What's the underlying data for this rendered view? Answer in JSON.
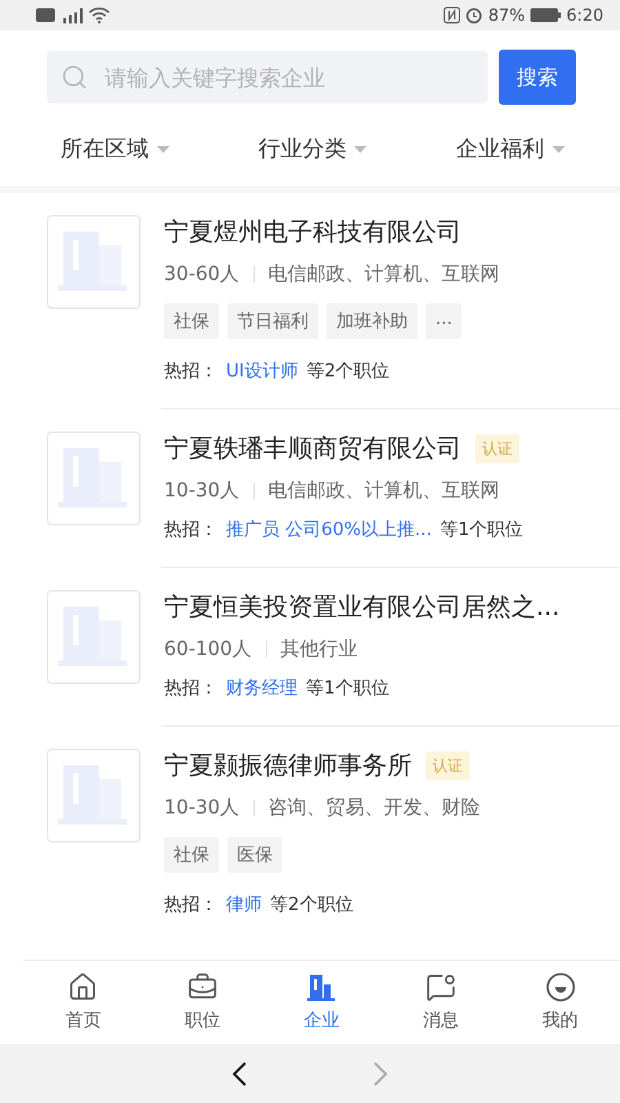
{
  "status_bar": {
    "battery": "87%",
    "time": "6:20"
  },
  "search": {
    "placeholder": "请输入关键字搜索企业",
    "button": "搜索"
  },
  "filters": [
    {
      "label": "所在区域"
    },
    {
      "label": "行业分类"
    },
    {
      "label": "企业福利"
    }
  ],
  "companies": [
    {
      "name": "宁夏煜州电子科技有限公司",
      "verified": false,
      "size": "30-60人",
      "industry": "电信邮政、计算机、互联网",
      "tags": [
        "社保",
        "节日福利",
        "加班补助",
        "..."
      ],
      "hot_label": "热招：",
      "hot_job": "UI设计师",
      "hot_count": "等2个职位"
    },
    {
      "name": "宁夏轶璠丰顺商贸有限公司",
      "verified": true,
      "badge": "认证",
      "size": "10-30人",
      "industry": "电信邮政、计算机、互联网",
      "hot_label": "热招：",
      "hot_job": "推广员 公司60%以上推...",
      "hot_count": "等1个职位"
    },
    {
      "name": "宁夏恒美投资置业有限公司居然之...",
      "verified": false,
      "size": "60-100人",
      "industry": "其他行业",
      "hot_label": "热招：",
      "hot_job": "财务经理",
      "hot_count": "等1个职位"
    },
    {
      "name": "宁夏颢振德律师事务所",
      "verified": true,
      "badge": "认证",
      "size": "10-30人",
      "industry": "咨询、贸易、开发、财险",
      "tags": [
        "社保",
        "医保"
      ],
      "hot_label": "热招：",
      "hot_job": "律师",
      "hot_count": "等2个职位"
    }
  ],
  "tabs": [
    {
      "label": "首页",
      "kind": "home",
      "selected": false
    },
    {
      "label": "职位",
      "kind": "briefcase",
      "selected": false
    },
    {
      "label": "企业",
      "kind": "building",
      "selected": true
    },
    {
      "label": "消息",
      "kind": "message",
      "selected": false
    },
    {
      "label": "我的",
      "kind": "profile",
      "selected": false
    }
  ],
  "system_nav": {
    "back_disabled": false,
    "forward_disabled": true
  }
}
